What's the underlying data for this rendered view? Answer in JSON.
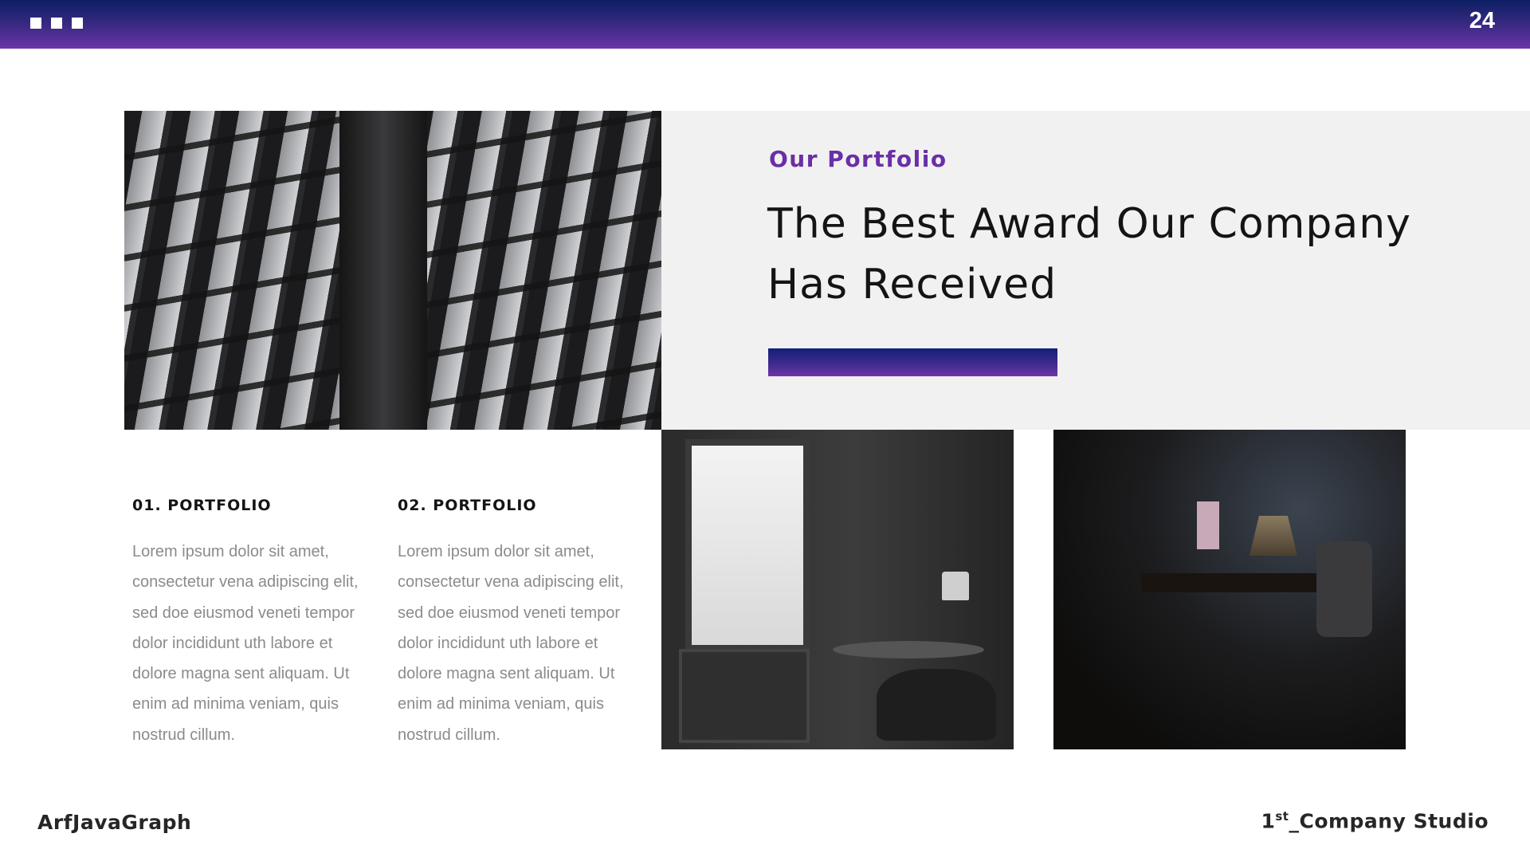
{
  "header": {
    "page_number": "24"
  },
  "hero": {
    "eyebrow": "Our Portfolio",
    "headline": "The Best Award Our Company Has Received"
  },
  "columns": [
    {
      "title": "01. PORTFOLIO",
      "body": "Lorem ipsum dolor sit amet, consectetur vena adipiscing elit, sed doe eiusmod veneti tempor dolor incididunt uth labore et dolore magna sent aliquam.  Ut enim ad minima veniam, quis nostrud cillum."
    },
    {
      "title": "02. PORTFOLIO",
      "body": "Lorem ipsum dolor sit amet, consectetur vena adipiscing elit, sed doe eiusmod veneti tempor dolor incididunt uth labore et dolore magna sent aliquam.  Ut enim ad minima veniam, quis nostrud cillum."
    }
  ],
  "footer": {
    "brand": "ArfJavaGraph",
    "studio_prefix": "1",
    "studio_sup": "st",
    "studio_suffix": "_Company Studio"
  },
  "colors": {
    "header_gradient": [
      "#0c1f63",
      "#6a36a8"
    ],
    "accent": "#6a2fa6",
    "panel": "#f1f1f1"
  }
}
